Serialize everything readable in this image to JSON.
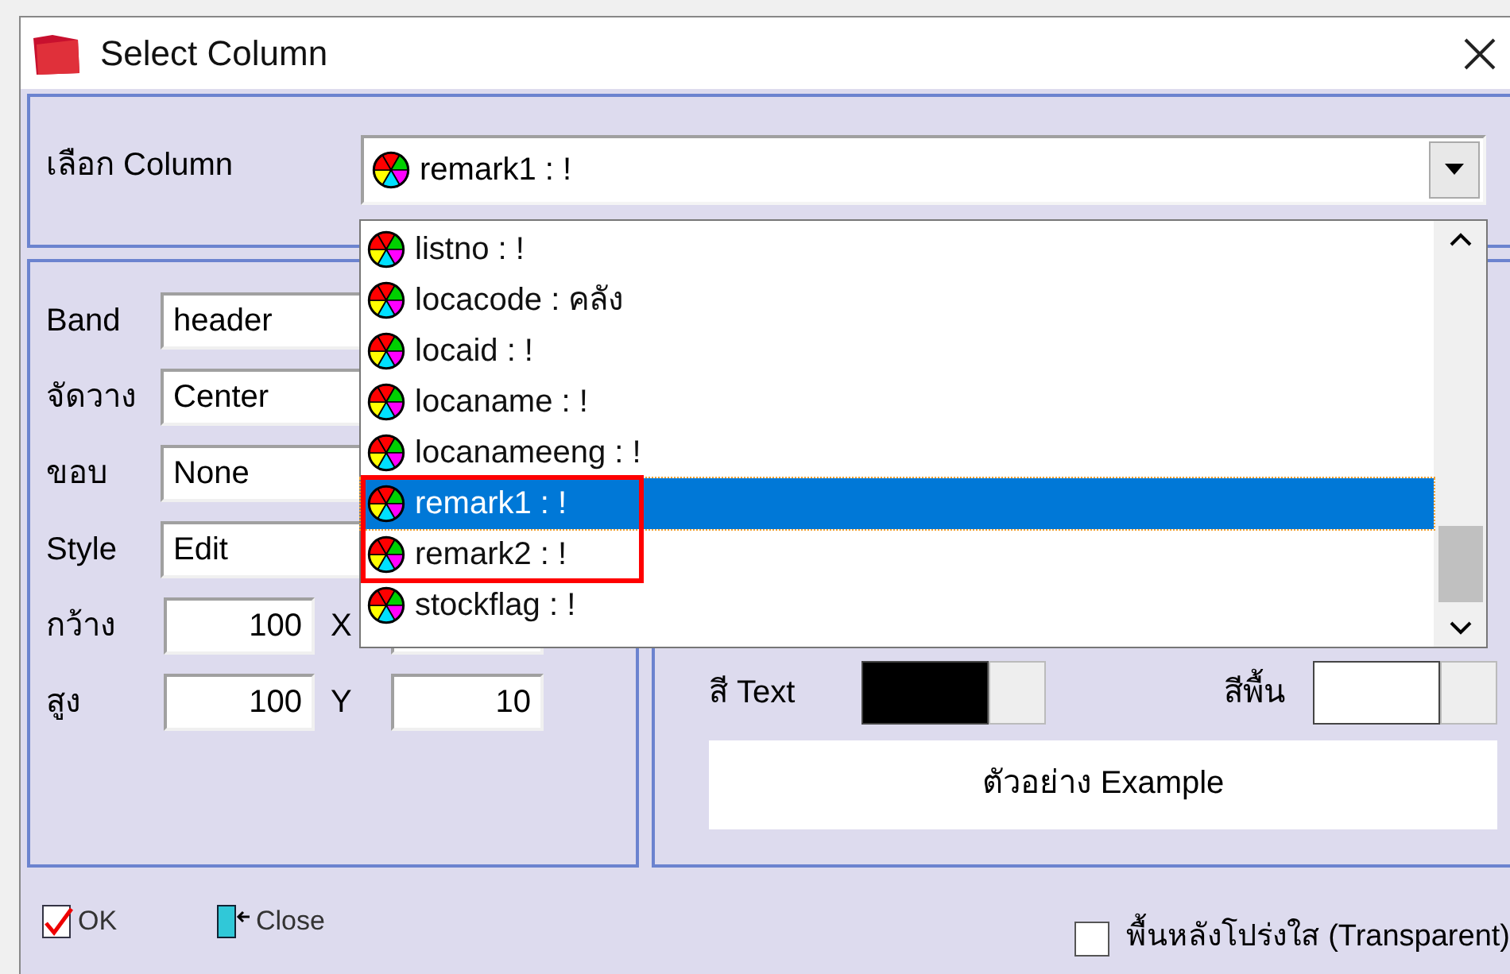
{
  "window": {
    "title": "Select Column"
  },
  "column_select": {
    "label": "เลือก Column",
    "value": "remark1 : !",
    "expanded": true
  },
  "dropdown": {
    "items": [
      {
        "label": "listno : !",
        "selected": false,
        "highlighted": false
      },
      {
        "label": "locacode : คลัง",
        "selected": false,
        "highlighted": false
      },
      {
        "label": "locaid : !",
        "selected": false,
        "highlighted": false
      },
      {
        "label": "locaname : !",
        "selected": false,
        "highlighted": false
      },
      {
        "label": "locanameeng : !",
        "selected": false,
        "highlighted": false
      },
      {
        "label": "remark1 : !",
        "selected": true,
        "highlighted": true
      },
      {
        "label": "remark2 : !",
        "selected": false,
        "highlighted": true
      },
      {
        "label": "stockflag : !",
        "selected": false,
        "highlighted": false
      }
    ]
  },
  "properties": {
    "fields": [
      {
        "label": "Band",
        "value": "header"
      },
      {
        "label": "จัดวาง",
        "value": "Center"
      },
      {
        "label": "ขอบ",
        "value": "None"
      },
      {
        "label": "Style",
        "value": "Edit"
      }
    ],
    "size": [
      {
        "label": "กว้าง",
        "value": "100",
        "pos_label": "X"
      },
      {
        "label": "สูง",
        "value": "100",
        "pos_label": "Y",
        "pos_value": "10"
      }
    ]
  },
  "appearance": {
    "text_color": {
      "label": "สี Text",
      "color": "#000000"
    },
    "background_color": {
      "label": "สีพื้น",
      "color": "#ffffff"
    },
    "preview": "ตัวอย่าง Example"
  },
  "buttons": [
    {
      "label": "OK",
      "kind": "ok"
    },
    {
      "label": "Close",
      "kind": "close"
    }
  ],
  "transparent": {
    "label": "พื้นหลังโปร่งใส (Transparent)",
    "checked": false
  }
}
